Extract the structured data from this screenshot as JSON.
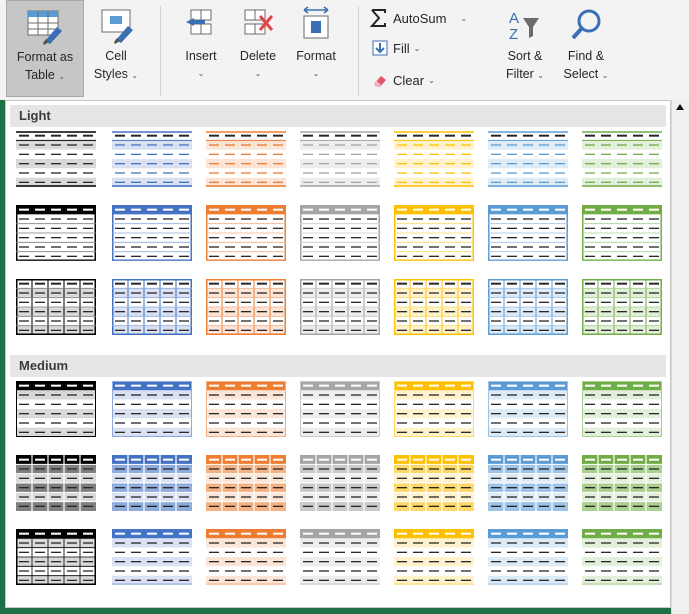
{
  "ribbon": {
    "format_as_table": {
      "line1": "Format as",
      "line2": "Table",
      "chevron": "⌄"
    },
    "cell_styles": {
      "line1": "Cell",
      "line2": "Styles",
      "chevron": "⌄"
    },
    "insert": {
      "label": "Insert",
      "chevron": "⌄"
    },
    "delete": {
      "label": "Delete",
      "chevron": "⌄"
    },
    "format": {
      "label": "Format",
      "chevron": "⌄"
    },
    "autosum": {
      "label": "AutoSum",
      "chevron": "⌄"
    },
    "fill": {
      "label": "Fill",
      "chevron": "⌄"
    },
    "clear": {
      "label": "Clear",
      "chevron": "⌄"
    },
    "sort_filter": {
      "line1": "Sort &",
      "line2": "Filter",
      "chevron": "⌄"
    },
    "find_select": {
      "line1": "Find &",
      "line2": "Select",
      "chevron": "⌄"
    }
  },
  "gallery": {
    "sections": [
      {
        "title": "Light"
      },
      {
        "title": "Medium"
      }
    ],
    "colors": {
      "black": {
        "dark": "#000000",
        "mid": "#7f7f7f",
        "light": "#d9d9d9"
      },
      "blue": {
        "dark": "#4472c4",
        "mid": "#8faadc",
        "light": "#d9e1f2"
      },
      "orange": {
        "dark": "#ed7d31",
        "mid": "#f4b183",
        "light": "#fce4d6"
      },
      "gray": {
        "dark": "#a5a5a5",
        "mid": "#c9c9c9",
        "light": "#ededed"
      },
      "gold": {
        "dark": "#ffc000",
        "mid": "#ffd966",
        "light": "#fff2cc"
      },
      "lightblue": {
        "dark": "#5b9bd5",
        "mid": "#9dc3e6",
        "light": "#ddebf7"
      },
      "green": {
        "dark": "#70ad47",
        "mid": "#a9d08e",
        "light": "#e2efda"
      }
    },
    "color_order": [
      "black",
      "blue",
      "orange",
      "gray",
      "gold",
      "lightblue",
      "green"
    ],
    "rows": [
      {
        "section": "Light",
        "variant": "light-banded"
      },
      {
        "section": "Light",
        "variant": "light-header-border"
      },
      {
        "section": "Light",
        "variant": "light-grid"
      },
      {
        "section": "Medium",
        "variant": "medium-header-banded"
      },
      {
        "section": "Medium",
        "variant": "medium-grid"
      },
      {
        "section": "Medium",
        "variant": "medium-plain"
      }
    ]
  }
}
